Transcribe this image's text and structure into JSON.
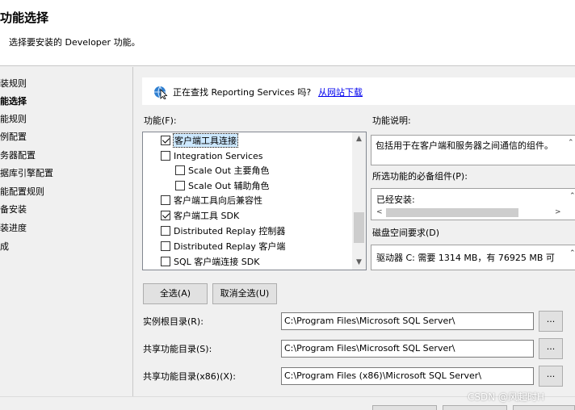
{
  "header": {
    "title": "功能选择",
    "subtitle": "选择要安装的 Developer 功能。"
  },
  "steps": [
    {
      "label": "装规则",
      "active": false
    },
    {
      "label": "能选择",
      "active": true
    },
    {
      "label": "能规则",
      "active": false
    },
    {
      "label": "例配置",
      "active": false
    },
    {
      "label": "务器配置",
      "active": false
    },
    {
      "label": "据库引擎配置",
      "active": false
    },
    {
      "label": "能配置规则",
      "active": false
    },
    {
      "label": "备安装",
      "active": false
    },
    {
      "label": "装进度",
      "active": false
    },
    {
      "label": "成",
      "active": false
    }
  ],
  "banner": {
    "text": "正在查找 Reporting Services 吗?",
    "link": "从网站下载"
  },
  "features": {
    "label": "功能(F):",
    "items": [
      {
        "label": "客户端工具连接",
        "checked": true,
        "selected": true,
        "indent": 0
      },
      {
        "label": "Integration Services",
        "checked": false,
        "selected": false,
        "indent": 0
      },
      {
        "label": "Scale Out 主要角色",
        "checked": false,
        "selected": false,
        "indent": 1
      },
      {
        "label": "Scale Out 辅助角色",
        "checked": false,
        "selected": false,
        "indent": 1
      },
      {
        "label": "客户端工具向后兼容性",
        "checked": false,
        "selected": false,
        "indent": 0
      },
      {
        "label": "客户端工具 SDK",
        "checked": true,
        "selected": false,
        "indent": 0
      },
      {
        "label": "Distributed Replay 控制器",
        "checked": false,
        "selected": false,
        "indent": 0
      },
      {
        "label": "Distributed Replay 客户端",
        "checked": false,
        "selected": false,
        "indent": 0
      },
      {
        "label": "SQL 客户端连接 SDK",
        "checked": false,
        "selected": false,
        "indent": 0
      }
    ]
  },
  "description": {
    "label": "功能说明:",
    "text": "包括用于在客户端和服务器之间通信的组件。"
  },
  "prereq": {
    "label": "所选功能的必备组件(P):",
    "text": "已经安装:"
  },
  "disk": {
    "label": "磁盘空间要求(D)",
    "text": "驱动器 C: 需要 1314 MB，有 76925 MB 可"
  },
  "buttons": {
    "select_all": "全选(A)",
    "unselect_all": "取消全选(U)",
    "browse": "..."
  },
  "paths": [
    {
      "label": "实例根目录(R):",
      "value": "C:\\Program Files\\Microsoft SQL Server\\"
    },
    {
      "label": "共享功能目录(S):",
      "value": "C:\\Program Files\\Microsoft SQL Server\\"
    },
    {
      "label": "共享功能目录(x86)(X):",
      "value": "C:\\Program Files (x86)\\Microsoft SQL Server\\"
    }
  ],
  "watermark": "CSDN @风起时H",
  "icons": {
    "banner": "globe-cursor-icon",
    "scroll_up": "chevron-up-icon",
    "scroll_down": "chevron-down-icon"
  }
}
